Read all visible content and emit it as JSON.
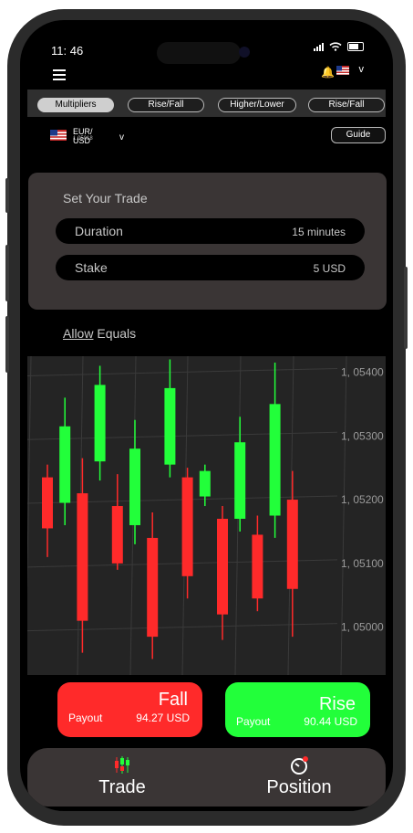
{
  "status": {
    "time": "11: 46"
  },
  "tabs": [
    {
      "label": "Multipliers"
    },
    {
      "label": "Rise/Fall"
    },
    {
      "label": "Higher/Lower"
    },
    {
      "label": "Rise/Fall"
    }
  ],
  "asset": {
    "symbol": "EUR/ USD",
    "price": "1.05018"
  },
  "guide_label": "Guide",
  "trade": {
    "title": "Set Your Trade",
    "duration_label": "Duration",
    "duration_value": "15 minutes",
    "stake_label": "Stake",
    "stake_value": "5 USD"
  },
  "allow_equals": {
    "first": "Allow",
    "second": " Equals"
  },
  "chart_data": {
    "type": "candlestick",
    "y_ticks": [
      "1, 05400",
      "1, 05300",
      "1, 05200",
      "1, 05100",
      "1, 05000"
    ],
    "candles": [
      {
        "open": 1.05235,
        "close": 1.05155,
        "high": 1.05255,
        "low": 1.0511,
        "dir": "fall"
      },
      {
        "open": 1.05195,
        "close": 1.05315,
        "high": 1.0536,
        "low": 1.0516,
        "dir": "rise"
      },
      {
        "open": 1.0521,
        "close": 1.0501,
        "high": 1.05265,
        "low": 1.0496,
        "dir": "fall"
      },
      {
        "open": 1.0526,
        "close": 1.0538,
        "high": 1.0541,
        "low": 1.0523,
        "dir": "rise"
      },
      {
        "open": 1.0519,
        "close": 1.051,
        "high": 1.0524,
        "low": 1.0509,
        "dir": "fall"
      },
      {
        "open": 1.0516,
        "close": 1.0528,
        "high": 1.05325,
        "low": 1.0513,
        "dir": "rise"
      },
      {
        "open": 1.0514,
        "close": 1.04985,
        "high": 1.0518,
        "low": 1.0495,
        "dir": "fall"
      },
      {
        "open": 1.05255,
        "close": 1.05375,
        "high": 1.0542,
        "low": 1.05235,
        "dir": "rise"
      },
      {
        "open": 1.05235,
        "close": 1.0508,
        "high": 1.0525,
        "low": 1.05045,
        "dir": "fall"
      },
      {
        "open": 1.05205,
        "close": 1.05245,
        "high": 1.05255,
        "low": 1.0519,
        "dir": "rise"
      },
      {
        "open": 1.0517,
        "close": 1.0502,
        "high": 1.0519,
        "low": 1.0498,
        "dir": "fall"
      },
      {
        "open": 1.0517,
        "close": 1.0529,
        "high": 1.0533,
        "low": 1.0515,
        "dir": "rise"
      },
      {
        "open": 1.05145,
        "close": 1.05045,
        "high": 1.05175,
        "low": 1.05025,
        "dir": "fall"
      },
      {
        "open": 1.05175,
        "close": 1.0535,
        "high": 1.05415,
        "low": 1.0514,
        "dir": "rise"
      },
      {
        "open": 1.052,
        "close": 1.0506,
        "high": 1.05245,
        "low": 1.04985,
        "dir": "fall"
      }
    ],
    "ylim": [
      1.04925,
      1.05425
    ],
    "colors": {
      "rise": "#22ff3a",
      "fall": "#ff2a2a"
    }
  },
  "fall": {
    "label": "Fall",
    "payout_label": "Payout",
    "payout": "94.27 USD"
  },
  "rise": {
    "label": "Rise",
    "payout_label": "Payout",
    "payout": "90.44 USD"
  },
  "nav": {
    "trade": "Trade",
    "position": "Position"
  }
}
